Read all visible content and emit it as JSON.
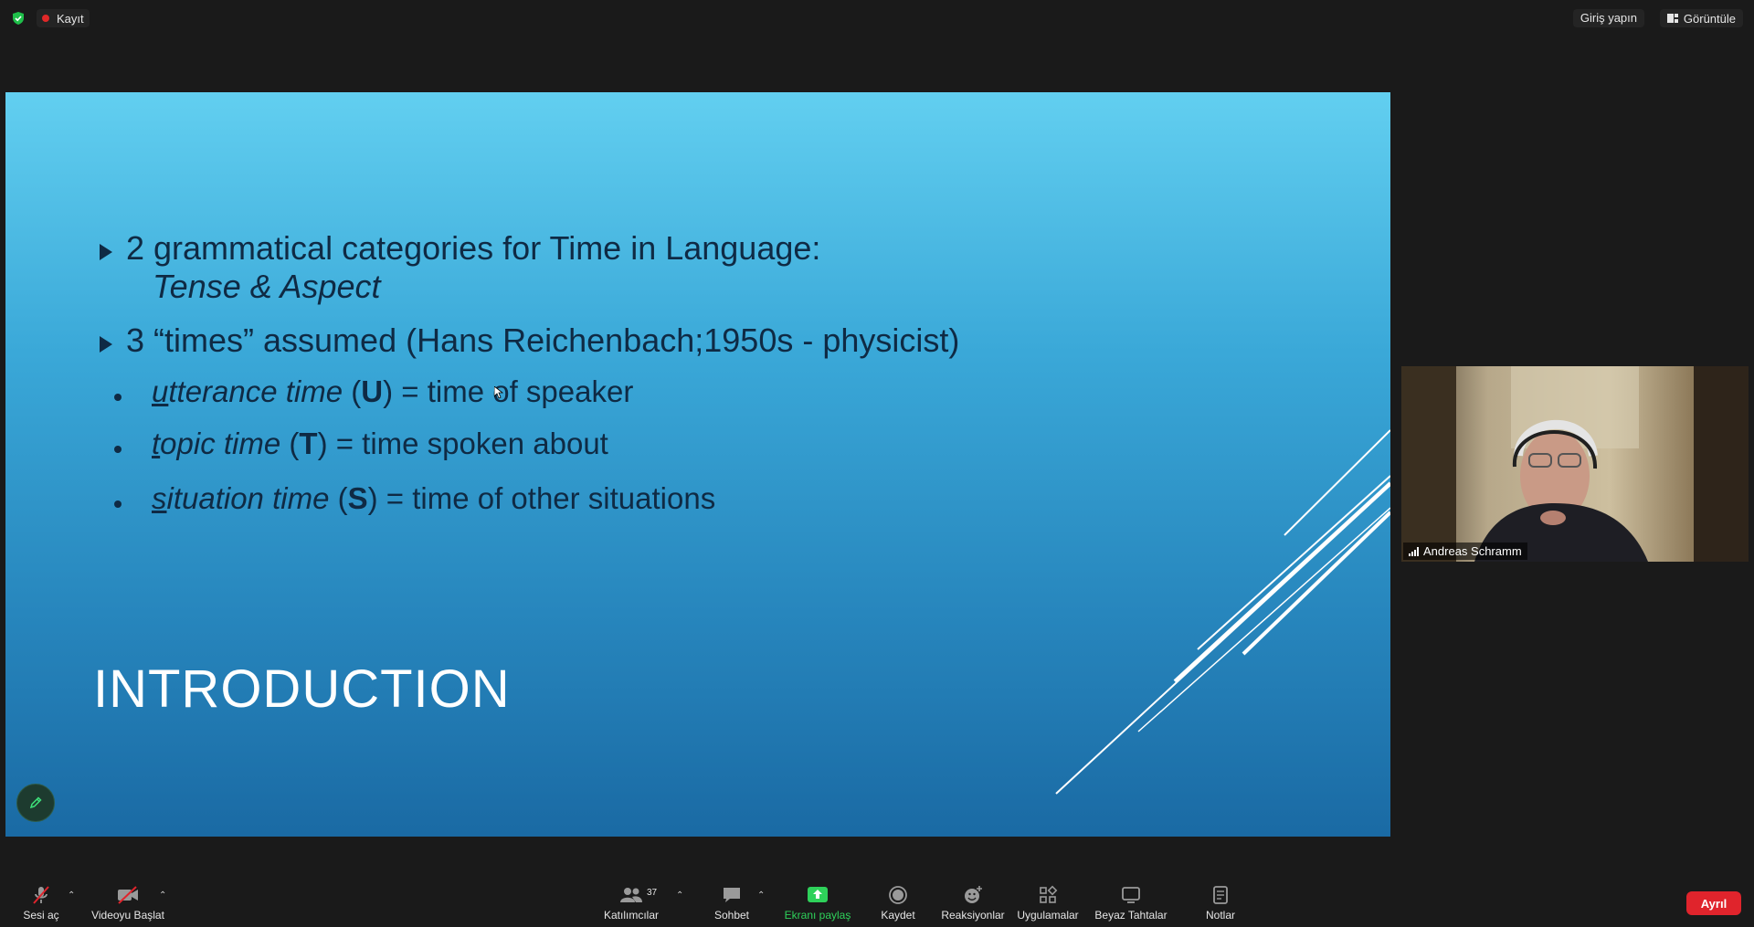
{
  "topbar": {
    "record_label": "Kayıt",
    "signin_label": "Giriş yapın",
    "view_label": "Görüntüle"
  },
  "slide": {
    "bullet1_line1": "2 grammatical categories for Time in Language:",
    "bullet1_line2": "Tense & Aspect",
    "bullet2": "3 “times” assumed (Hans Reichenbach;1950s - physicist)",
    "sub1": {
      "first": "u",
      "rest": "tterance time",
      "open": " (",
      "key": "U",
      "close": ") = time of speaker"
    },
    "sub2": {
      "first": "t",
      "rest": "opic time",
      "open": " (",
      "key": "T",
      "close": ") = time spoken about"
    },
    "sub3": {
      "first": "s",
      "rest": "ituation time",
      "open": " (",
      "key": "S",
      "close": ") = time of other situations"
    },
    "title": "INTRODUCTION"
  },
  "video": {
    "participant_name": "Andreas Schramm"
  },
  "toolbar": {
    "mute_label": "Sesi aç",
    "video_label": "Videoyu Başlat",
    "participants_label": "Katılımcılar",
    "participants_count": "37",
    "chat_label": "Sohbet",
    "share_label": "Ekranı paylaş",
    "record_label": "Kaydet",
    "reactions_label": "Reaksiyonlar",
    "apps_label": "Uygulamalar",
    "whiteboard_label": "Beyaz Tahtalar",
    "notes_label": "Notlar",
    "leave_label": "Ayrıl"
  },
  "colors": {
    "leave": "#e0242c",
    "share": "#2ed15a",
    "record_dot": "#e02828"
  }
}
